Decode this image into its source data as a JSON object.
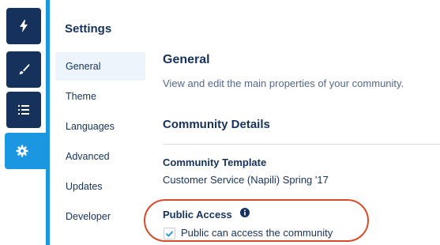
{
  "rail": {
    "items": [
      {
        "icon": "lightning-icon",
        "active": false
      },
      {
        "icon": "paintbrush-icon",
        "active": false
      },
      {
        "icon": "list-icon",
        "active": false
      },
      {
        "icon": "gear-icon",
        "active": true
      }
    ]
  },
  "settings": {
    "title": "Settings",
    "nav": [
      {
        "label": "General",
        "active": true
      },
      {
        "label": "Theme",
        "active": false
      },
      {
        "label": "Languages",
        "active": false
      },
      {
        "label": "Advanced",
        "active": false
      },
      {
        "label": "Updates",
        "active": false
      },
      {
        "label": "Developer",
        "active": false
      }
    ]
  },
  "main": {
    "heading": "General",
    "description": "View and edit the main properties of your community.",
    "section_heading": "Community Details",
    "template_label": "Community Template",
    "template_value": "Customer Service (Napili) Spring '17",
    "public_access_label": "Public Access",
    "public_access_checkbox_label": "Public can access the community",
    "public_access_checked": true
  },
  "colors": {
    "navy": "#16325c",
    "accent_blue": "#1b96e0",
    "highlight_red": "#d84a2a",
    "checkbox_blue": "#1b96e0"
  }
}
